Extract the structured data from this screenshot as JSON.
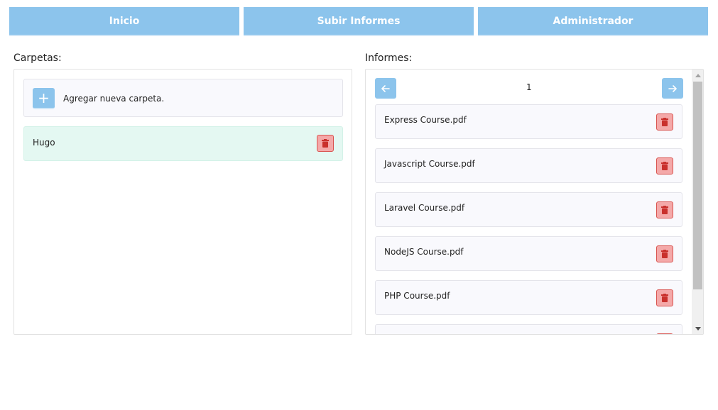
{
  "nav": {
    "items": [
      {
        "label": "Inicio"
      },
      {
        "label": "Subir Informes"
      },
      {
        "label": "Administrador"
      }
    ]
  },
  "folders": {
    "title": "Carpetas:",
    "add_label": "Agregar nueva carpeta.",
    "add_icon": "+",
    "items": [
      {
        "label": "Hugo"
      }
    ]
  },
  "reports": {
    "title": "Informes:",
    "page": "1",
    "files": [
      {
        "label": "Express Course.pdf"
      },
      {
        "label": "Javascript Course.pdf"
      },
      {
        "label": "Laravel Course.pdf"
      },
      {
        "label": "NodeJS Course.pdf"
      },
      {
        "label": "PHP Course.pdf"
      },
      {
        "label": ""
      }
    ]
  },
  "colors": {
    "nav_bg": "#8cc4ec",
    "folder_selected_bg": "#e4f8f2",
    "delete_bg": "#f4a9a9",
    "delete_border": "#d9534f",
    "delete_icon": "#c9302c"
  }
}
